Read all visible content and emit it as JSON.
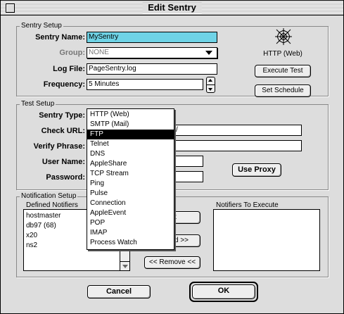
{
  "window": {
    "title": "Edit Sentry"
  },
  "sentry_setup": {
    "group_label": "Sentry Setup",
    "name_label": "Sentry Name:",
    "name_value": "MySentry",
    "group_field_label": "Group:",
    "group_value": "NONE",
    "logfile_label": "Log File:",
    "logfile_value": "PageSentry.log",
    "frequency_label": "Frequency:",
    "frequency_value": "5 Minutes",
    "type_icon_label": "HTTP (Web)",
    "execute_test_label": "Execute Test",
    "set_schedule_label": "Set Schedule"
  },
  "test_setup": {
    "group_label": "Test Setup",
    "type_label": "Sentry Type:",
    "checkurl_label": "Check URL:",
    "checkurl_value_visible": "/",
    "verify_label": "Verify Phrase:",
    "username_label": "User Name:",
    "password_label": "Password:",
    "use_proxy_label": "Use Proxy"
  },
  "type_menu": {
    "items": [
      "HTTP (Web)",
      "SMTP (Mail)",
      "FTP",
      "Telnet",
      "DNS",
      "AppleShare",
      "TCP Stream",
      "Ping",
      "Pulse",
      "Connection",
      "AppleEvent",
      "POP",
      "IMAP",
      "Process Watch"
    ],
    "highlighted": "FTP"
  },
  "notification_setup": {
    "group_label": "Notification Setup",
    "defined_label": "Defined Notifiers",
    "defined": [
      "hostmaster",
      "db97 (68)",
      "x20",
      "ns2"
    ],
    "execute_label": "Notifiers To Execute",
    "add_partial": "t",
    "add_all_partial": "d >>",
    "remove_label": "<< Remove <<"
  },
  "buttons": {
    "cancel": "Cancel",
    "ok": "OK"
  }
}
